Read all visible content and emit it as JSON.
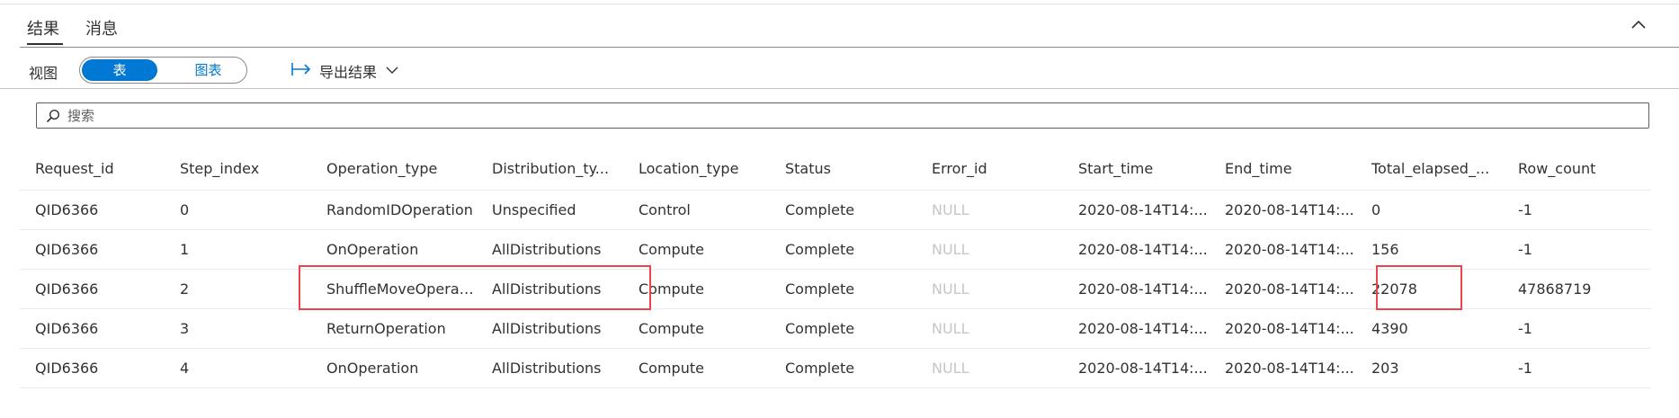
{
  "tabs": [
    {
      "label": "结果",
      "active": true
    },
    {
      "label": "消息",
      "active": false
    }
  ],
  "toolbar": {
    "view_label": "视图",
    "view_options": [
      "表",
      "图表"
    ],
    "selected_view": "表",
    "export_label": "导出结果"
  },
  "search": {
    "placeholder": "搜索",
    "value": ""
  },
  "table": {
    "columns": [
      "Request_id",
      "Step_index",
      "Operation_type",
      "Distribution_ty...",
      "Location_type",
      "Status",
      "Error_id",
      "Start_time",
      "End_time",
      "Total_elapsed_...",
      "Row_count"
    ],
    "rows": [
      [
        "QID6366",
        "0",
        "RandomIDOperation",
        "Unspecified",
        "Control",
        "Complete",
        "NULL",
        "2020-08-14T14:...",
        "2020-08-14T14:...",
        "0",
        "-1"
      ],
      [
        "QID6366",
        "1",
        "OnOperation",
        "AllDistributions",
        "Compute",
        "Complete",
        "NULL",
        "2020-08-14T14:...",
        "2020-08-14T14:...",
        "156",
        "-1"
      ],
      [
        "QID6366",
        "2",
        "ShuffleMoveOperation",
        "AllDistributions",
        "Compute",
        "Complete",
        "NULL",
        "2020-08-14T14:...",
        "2020-08-14T14:...",
        "22078",
        "47868719"
      ],
      [
        "QID6366",
        "3",
        "ReturnOperation",
        "AllDistributions",
        "Compute",
        "Complete",
        "NULL",
        "2020-08-14T14:...",
        "2020-08-14T14:...",
        "4390",
        "-1"
      ],
      [
        "QID6366",
        "4",
        "OnOperation",
        "AllDistributions",
        "Compute",
        "Complete",
        "NULL",
        "2020-08-14T14:...",
        "2020-08-14T14:...",
        "203",
        "-1"
      ]
    ]
  },
  "colors": {
    "accent": "#0078d4",
    "highlight": "#e8454c",
    "null_text": "#c8c6c4"
  },
  "icons": {
    "export": "arrow-right-bar-icon",
    "collapse": "chevron-up-icon",
    "search": "search-icon",
    "dropdown": "chevron-down-icon"
  }
}
